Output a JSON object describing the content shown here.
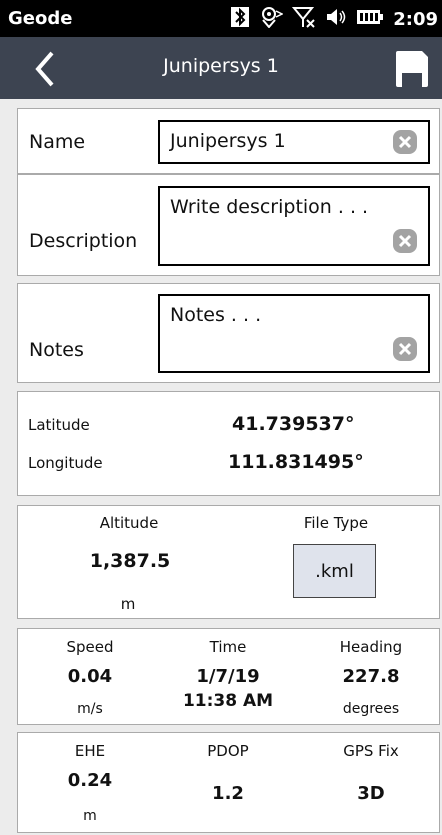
{
  "status_bar": {
    "app_name": "Geode",
    "clock": "2:09",
    "icons": [
      "bluetooth-icon",
      "gps-icon",
      "no-signal-icon",
      "volume-icon",
      "battery-icon"
    ]
  },
  "title_bar": {
    "title": "Junipersys 1",
    "icons": [
      "back-chevron-icon",
      "save-icon"
    ]
  },
  "form": {
    "name": {
      "label": "Name",
      "value": "Junipersys 1"
    },
    "description": {
      "label": "Description",
      "placeholder": "Write description . . ."
    },
    "notes": {
      "label": "Notes",
      "placeholder": "Notes . . ."
    }
  },
  "position": {
    "latitude_label": "Latitude",
    "latitude_value": "41.739537°",
    "longitude_label": "Longitude",
    "longitude_value": "111.831495°"
  },
  "altitude": {
    "label": "Altitude",
    "value": "1,387.5",
    "unit": "m",
    "file_type_label": "File Type",
    "file_type_value": ".kml"
  },
  "motion": {
    "speed_label": "Speed",
    "speed_value": "0.04",
    "speed_unit": "m/s",
    "time_label": "Time",
    "time_date": "1/7/19",
    "time_clock": "11:38 AM",
    "heading_label": "Heading",
    "heading_value": "227.8",
    "heading_unit": "degrees"
  },
  "accuracy": {
    "ehe_label": "EHE",
    "ehe_value": "0.24",
    "ehe_unit": "m",
    "pdop_label": "PDOP",
    "pdop_value": "1.2",
    "gps_fix_label": "GPS Fix",
    "gps_fix_value": "3D"
  },
  "colors": {
    "status_bar": "#000000",
    "title_bar": "#3d4451",
    "background": "#ececec",
    "card": "#ffffff",
    "button": "#dfe3ec"
  }
}
